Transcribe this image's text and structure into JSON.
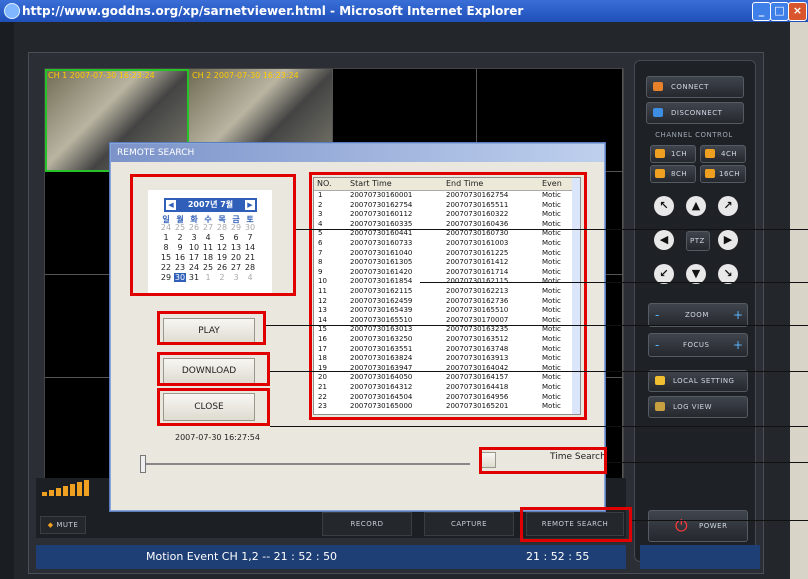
{
  "window": {
    "title": "http://www.goddns.org/xp/sarnetviewer.html - Microsoft Internet Explorer",
    "min_glyph": "_",
    "max_glyph": "□",
    "close_glyph": "×"
  },
  "cameras": [
    {
      "label": "CH 1 2007-07-30 16:23:24"
    },
    {
      "label": "CH 2 2007-07-30 16:23:24"
    }
  ],
  "control_panel": {
    "connect": "CONNECT",
    "disconnect": "DISCONNECT",
    "channel_control": "CHANNEL CONTROL",
    "ch1": "1CH",
    "ch4": "4CH",
    "ch8": "8CH",
    "ch16": "16CH",
    "ptz": "PTZ",
    "zoom": "ZOOM",
    "focus": "FOCUS",
    "local_setting": "LOCAL SETTING",
    "log_view": "LOG VIEW",
    "power": "POWER",
    "power_glyph": "⏻",
    "minus": "-",
    "plus": "+"
  },
  "bottom": {
    "mute": "MUTE",
    "record": "RECORD",
    "capture": "CAPTURE",
    "remote_search": "REMOTE SEARCH"
  },
  "status": {
    "message": "Motion Event CH 1,2 -- 21 : 52 : 50",
    "time": "21 : 52 : 55"
  },
  "dialog": {
    "title": "REMOTE SEARCH",
    "calendar": {
      "month": "2007년 7월",
      "weekdays": [
        "일",
        "월",
        "화",
        "수",
        "목",
        "금",
        "토"
      ],
      "weeks": [
        [
          "24",
          "25",
          "26",
          "27",
          "28",
          "29",
          "30"
        ],
        [
          "1",
          "2",
          "3",
          "4",
          "5",
          "6",
          "7"
        ],
        [
          "8",
          "9",
          "10",
          "11",
          "12",
          "13",
          "14"
        ],
        [
          "15",
          "16",
          "17",
          "18",
          "19",
          "20",
          "21"
        ],
        [
          "22",
          "23",
          "24",
          "25",
          "26",
          "27",
          "28"
        ],
        [
          "29",
          "30",
          "31",
          "1",
          "2",
          "3",
          "4"
        ]
      ],
      "prev": "◀",
      "next": "▶"
    },
    "play": "PLAY",
    "download": "DOWNLOAD",
    "close": "CLOSE",
    "datetime": "2007-07-30 16:27:54",
    "time_search": "Time Search",
    "list": {
      "headers": [
        "NO.",
        "Start Time",
        "End  Time",
        "Even"
      ],
      "rows": [
        [
          "1",
          "20070730160001",
          "20070730162754",
          "Motic"
        ],
        [
          "2",
          "20070730162754",
          "20070730165511",
          "Motic"
        ],
        [
          "3",
          "20070730160112",
          "20070730160322",
          "Motic"
        ],
        [
          "4",
          "20070730160335",
          "20070730160436",
          "Motic"
        ],
        [
          "5",
          "20070730160441",
          "20070730160730",
          "Motic"
        ],
        [
          "6",
          "20070730160733",
          "20070730161003",
          "Motic"
        ],
        [
          "7",
          "20070730161040",
          "20070730161225",
          "Motic"
        ],
        [
          "8",
          "20070730161305",
          "20070730161412",
          "Motic"
        ],
        [
          "9",
          "20070730161420",
          "20070730161714",
          "Motic"
        ],
        [
          "10",
          "20070730161854",
          "20070730162115",
          "Motic"
        ],
        [
          "11",
          "20070730162115",
          "20070730162213",
          "Motic"
        ],
        [
          "12",
          "20070730162459",
          "20070730162736",
          "Motic"
        ],
        [
          "13",
          "20070730165439",
          "20070730165510",
          "Motic"
        ],
        [
          "14",
          "20070730165510",
          "20070730170007",
          "Motic"
        ],
        [
          "15",
          "20070730163013",
          "20070730163235",
          "Motic"
        ],
        [
          "16",
          "20070730163250",
          "20070730163512",
          "Motic"
        ],
        [
          "17",
          "20070730163551",
          "20070730163748",
          "Motic"
        ],
        [
          "18",
          "20070730163824",
          "20070730163913",
          "Motic"
        ],
        [
          "19",
          "20070730163947",
          "20070730164042",
          "Motic"
        ],
        [
          "20",
          "20070730164050",
          "20070730164157",
          "Motic"
        ],
        [
          "21",
          "20070730164312",
          "20070730164418",
          "Motic"
        ],
        [
          "22",
          "20070730164504",
          "20070730164956",
          "Motic"
        ],
        [
          "23",
          "20070730165000",
          "20070730165201",
          "Motic"
        ]
      ]
    }
  },
  "colors": {
    "highlight": "#e00000",
    "active_channel": "#27c227",
    "status_bar": "#1d3f75",
    "dialog_bg": "#e9e7de"
  }
}
